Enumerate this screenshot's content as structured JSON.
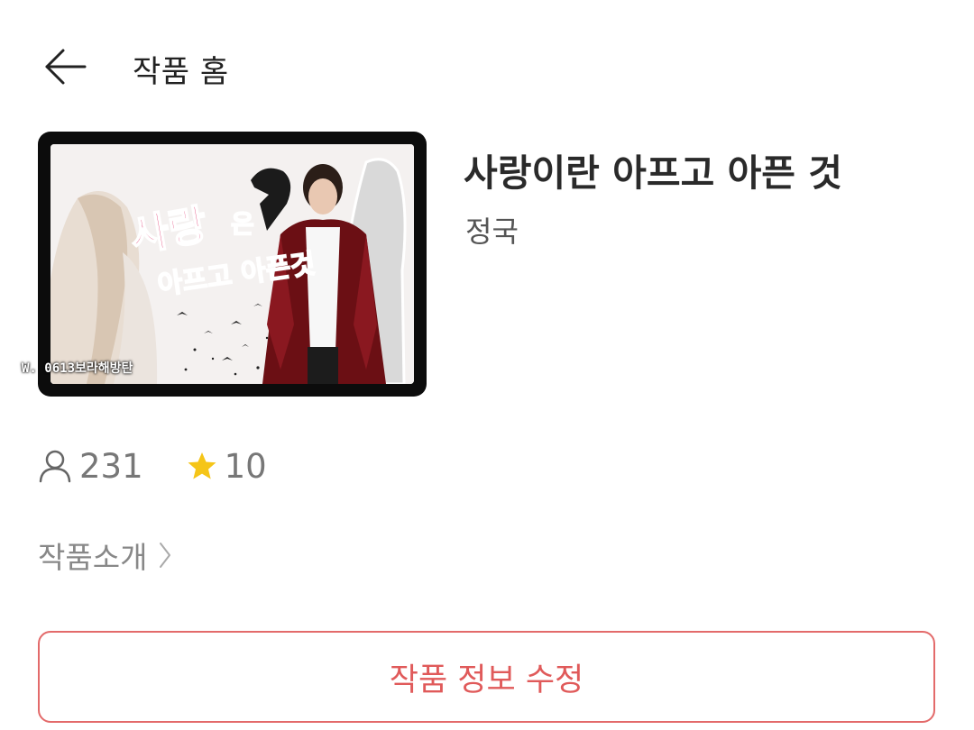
{
  "header": {
    "back_icon": "arrow-left-icon",
    "title": "작품 홈"
  },
  "work": {
    "title": "사랑이란 아프고 아픈 것",
    "author": "정국",
    "cover": {
      "image": "book-cover-image",
      "credit": "W. 0613보라해방탄"
    }
  },
  "stats": {
    "readers_icon": "person-icon",
    "readers": "231",
    "rating_icon": "star-icon",
    "rating": "10",
    "star_color": "#f5c518"
  },
  "intro": {
    "label": "작품소개",
    "icon": "chevron-right-icon"
  },
  "actions": {
    "edit_label": "작품 정보 수정",
    "accent": "#e05a5a"
  }
}
